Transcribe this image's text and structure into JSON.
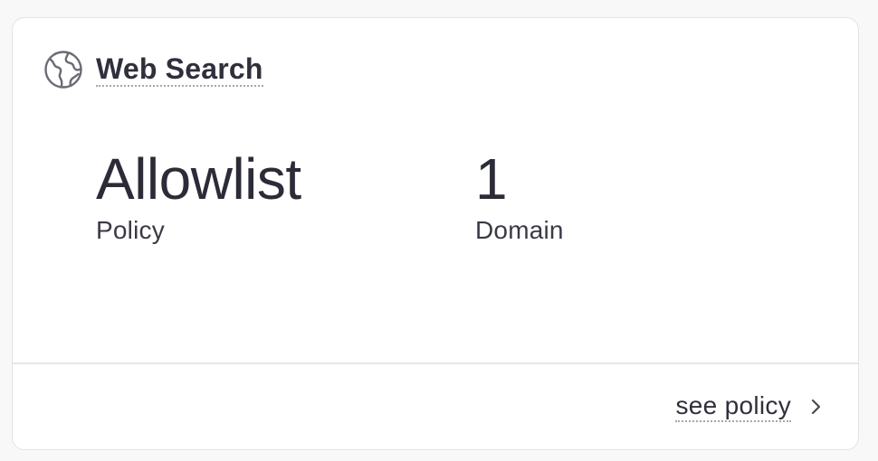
{
  "card": {
    "title": "Web Search",
    "icon": "globe-icon",
    "stats": [
      {
        "value": "Allowlist",
        "label": "Policy"
      },
      {
        "value": "1",
        "label": "Domain"
      }
    ],
    "footer": {
      "link_label": "see policy",
      "link_icon": "chevron-right-icon"
    }
  },
  "colors": {
    "text": "#30303c",
    "border": "#e3e3e6",
    "background": "#f8f8f8",
    "card_background": "#ffffff"
  }
}
